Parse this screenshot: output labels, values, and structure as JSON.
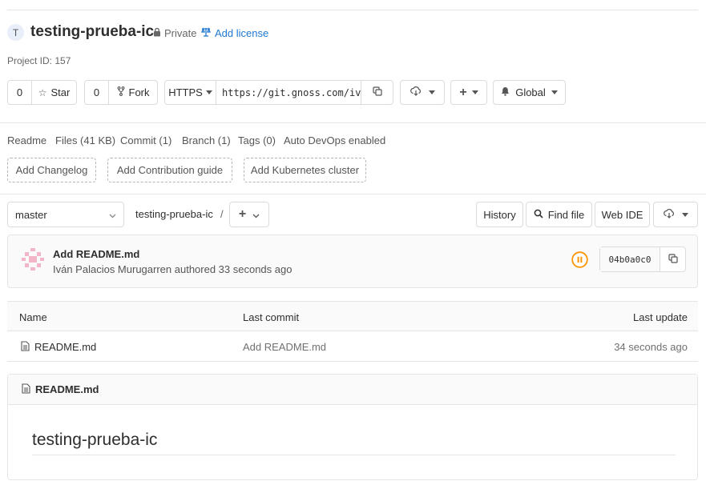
{
  "project": {
    "avatar_letter": "T",
    "name": "testing-prueba-ic",
    "visibility": "Private",
    "add_license": "Add license",
    "project_id": "Project ID: 157"
  },
  "actions": {
    "star_count": "0",
    "star_label": "Star",
    "fork_count": "0",
    "fork_label": "Fork",
    "protocol": "HTTPS",
    "clone_url": "https://git.gnoss.com/ivan.palacios/testing-prueba-ic.git",
    "notification": "Global"
  },
  "stats": {
    "readme": "Readme",
    "files": "Files (41 KB)",
    "commit": "Commit (1)",
    "branch": "Branch (1)",
    "tags": "Tags (0)",
    "autodevops": "Auto DevOps enabled"
  },
  "suggestions": {
    "changelog": "Add Changelog",
    "contribution": "Add Contribution guide",
    "kubernetes": "Add Kubernetes cluster"
  },
  "tree": {
    "branch": "master",
    "path": "testing-prueba-ic",
    "path_sep": "/",
    "history": "History",
    "find_file": "Find file",
    "web_ide": "Web IDE"
  },
  "commit": {
    "title": "Add README.md",
    "author_line": "Iván Palacios Murugarren authored 33 seconds ago",
    "sha": "04b0a0c0"
  },
  "files_table": {
    "headers": {
      "name": "Name",
      "last_commit": "Last commit",
      "last_update": "Last update"
    },
    "rows": [
      {
        "name": "README.md",
        "last_commit": "Add README.md",
        "last_update": "34 seconds ago"
      }
    ]
  },
  "readme": {
    "file_name": "README.md",
    "heading": "testing-prueba-ic"
  },
  "colors": {
    "link": "#1f78d1",
    "pipeline": "#fc9403",
    "border": "#e5e5e5"
  }
}
